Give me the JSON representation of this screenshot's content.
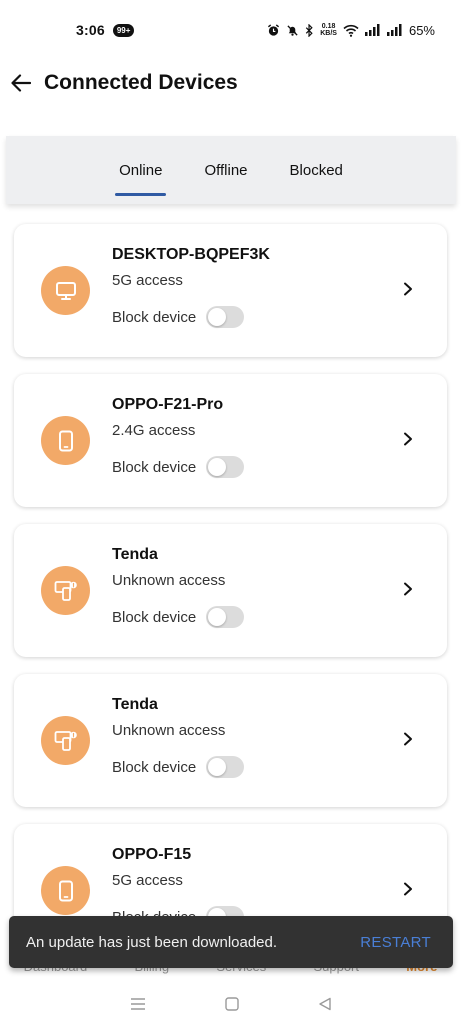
{
  "status_bar": {
    "time": "3:06",
    "notification_badge": "99+",
    "net_speed_value": "0.18",
    "net_speed_unit": "KB/S",
    "battery": "65%"
  },
  "header": {
    "title": "Connected Devices"
  },
  "tabs": [
    {
      "label": "Online",
      "active": true
    },
    {
      "label": "Offline",
      "active": false
    },
    {
      "label": "Blocked",
      "active": false
    }
  ],
  "block_label": "Block device",
  "devices": [
    {
      "name": "DESKTOP-BQPEF3K",
      "access": "5G access",
      "icon": "monitor-icon",
      "blocked": false
    },
    {
      "name": "OPPO-F21-Pro",
      "access": "2.4G access",
      "icon": "phone-icon",
      "blocked": false
    },
    {
      "name": "Tenda",
      "access": "Unknown access",
      "icon": "unknown-device-icon",
      "blocked": false
    },
    {
      "name": "Tenda",
      "access": "Unknown access",
      "icon": "unknown-device-icon",
      "blocked": false
    },
    {
      "name": "OPPO-F15",
      "access": "5G access",
      "icon": "phone-icon",
      "blocked": false
    }
  ],
  "bottom_nav": {
    "items": [
      "Dashboard",
      "Billing",
      "Services",
      "Support",
      "More"
    ]
  },
  "snackbar": {
    "message": "An update has just been downloaded.",
    "action": "RESTART"
  },
  "colors": {
    "accent": "#2f5aa3",
    "icon_bg": "#f2a968",
    "snackbar_bg": "#323232",
    "snackbar_action": "#4a7fd6",
    "nav_active": "#e48a2f"
  }
}
